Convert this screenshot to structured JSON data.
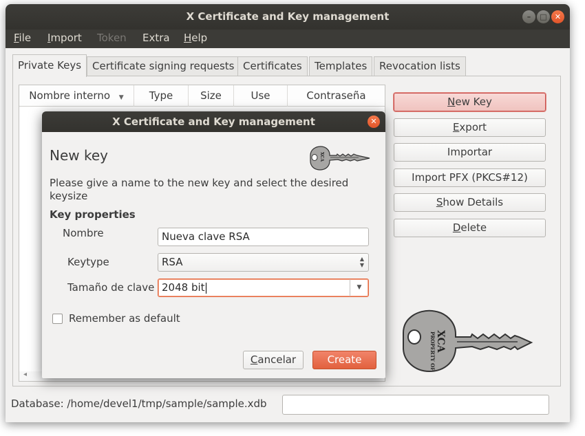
{
  "window": {
    "title": "X Certificate and Key management"
  },
  "menu": {
    "file": "File",
    "file_mnemonic": "F",
    "file_rest": "ile",
    "import_a": "I",
    "import_b": "mport",
    "token": "Token",
    "extra": "Extra",
    "help_a": "H",
    "help_b": "elp"
  },
  "tabs": [
    "Private Keys",
    "Certificate signing requests",
    "Certificates",
    "Templates",
    "Revocation lists"
  ],
  "list": {
    "columns": [
      "Nombre interno",
      "Type",
      "Size",
      "Use",
      "Contraseña"
    ],
    "sort_icon": "sort-desc-icon"
  },
  "side_buttons": {
    "new_key_a": "N",
    "new_key_b": "ew Key",
    "export_a": "E",
    "export_b": "xport",
    "import": "Importar",
    "import_pfx": "Import PFX (PKCS#12)",
    "show_details_a": "S",
    "show_details_b": "how Details",
    "delete_a": "D",
    "delete_b": "elete"
  },
  "key_logo_text": "PROPERTY OF XCA",
  "status": {
    "database_label": "Database: /home/devel1/tmp/sample/sample.xdb",
    "field_value": ""
  },
  "dialog": {
    "title": "X Certificate and Key management",
    "heading": "New key",
    "description": "Please give a name to the new key and select the desired keysize",
    "section": "Key properties",
    "name_label": "Nombre",
    "name_value": "Nueva clave RSA",
    "keytype_label": "Keytype",
    "keytype_value": "RSA",
    "keysize_label": "Tamaño de clave",
    "keysize_value": "2048 bit",
    "remember_label": "Remember as default",
    "remember_checked": false,
    "cancel_a": "C",
    "cancel_b": "ancelar",
    "create": "Create"
  },
  "colors": {
    "accent": "#e2613e",
    "titlebar": "#3c3b37",
    "default_button": "#f0c3bf"
  }
}
